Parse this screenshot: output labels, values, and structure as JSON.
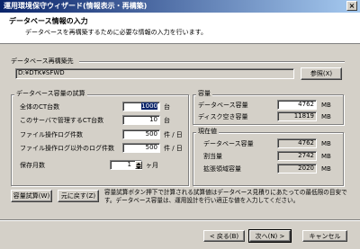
{
  "window": {
    "title": "運用環境保守ウィザード(情報表示・再構築)"
  },
  "header": {
    "title": "データベース情報の入力",
    "subtitle": "データベースを再構築するために必要な情報の入力を行います。"
  },
  "rebuild_dest": {
    "label": "データベース再構築先",
    "path": "D:¥DTK¥SFWD",
    "browse_label": "参照(X)"
  },
  "estimate": {
    "group_label": "データベース容量の試算",
    "rows": [
      {
        "label": "全体のCT台数",
        "value": "1000",
        "unit": "台"
      },
      {
        "label": "このサーバで管理するCT台数",
        "value": "10",
        "unit": "台"
      },
      {
        "label": "ファイル操作ログ件数",
        "value": "500",
        "unit": "件 / 日"
      },
      {
        "label": "ファイル操作ログ以外のログ件数",
        "value": "500",
        "unit": "件 / 日"
      }
    ],
    "retention": {
      "label": "保存月数",
      "value": "1",
      "unit": "ヶ月"
    }
  },
  "capacity": {
    "group_label": "容量",
    "rows": [
      {
        "label": "データベース容量",
        "value": "4762",
        "unit": "MB"
      },
      {
        "label": "ディスク空き容量",
        "value": "11819",
        "unit": "MB"
      }
    ]
  },
  "current": {
    "group_label": "現在値",
    "rows": [
      {
        "label": "データベース容量",
        "value": "4762",
        "unit": "MB"
      },
      {
        "label": "割当量",
        "value": "2742",
        "unit": "MB"
      },
      {
        "label": "拡張領域容量",
        "value": "2020",
        "unit": "MB"
      }
    ]
  },
  "actions": {
    "calc_label": "容量試算(W)",
    "reset_label": "元に戻す(Z)",
    "note": "容量試算ボタン押下で計算される試算値はデータベース見積りにあたっての最低限の目安です。データベース容量は、運用設計を行い適正な値を入力してください。"
  },
  "footer": {
    "back_label": "< 戻る(B)",
    "next_label": "次へ(N) >",
    "cancel_label": "キャンセル"
  }
}
